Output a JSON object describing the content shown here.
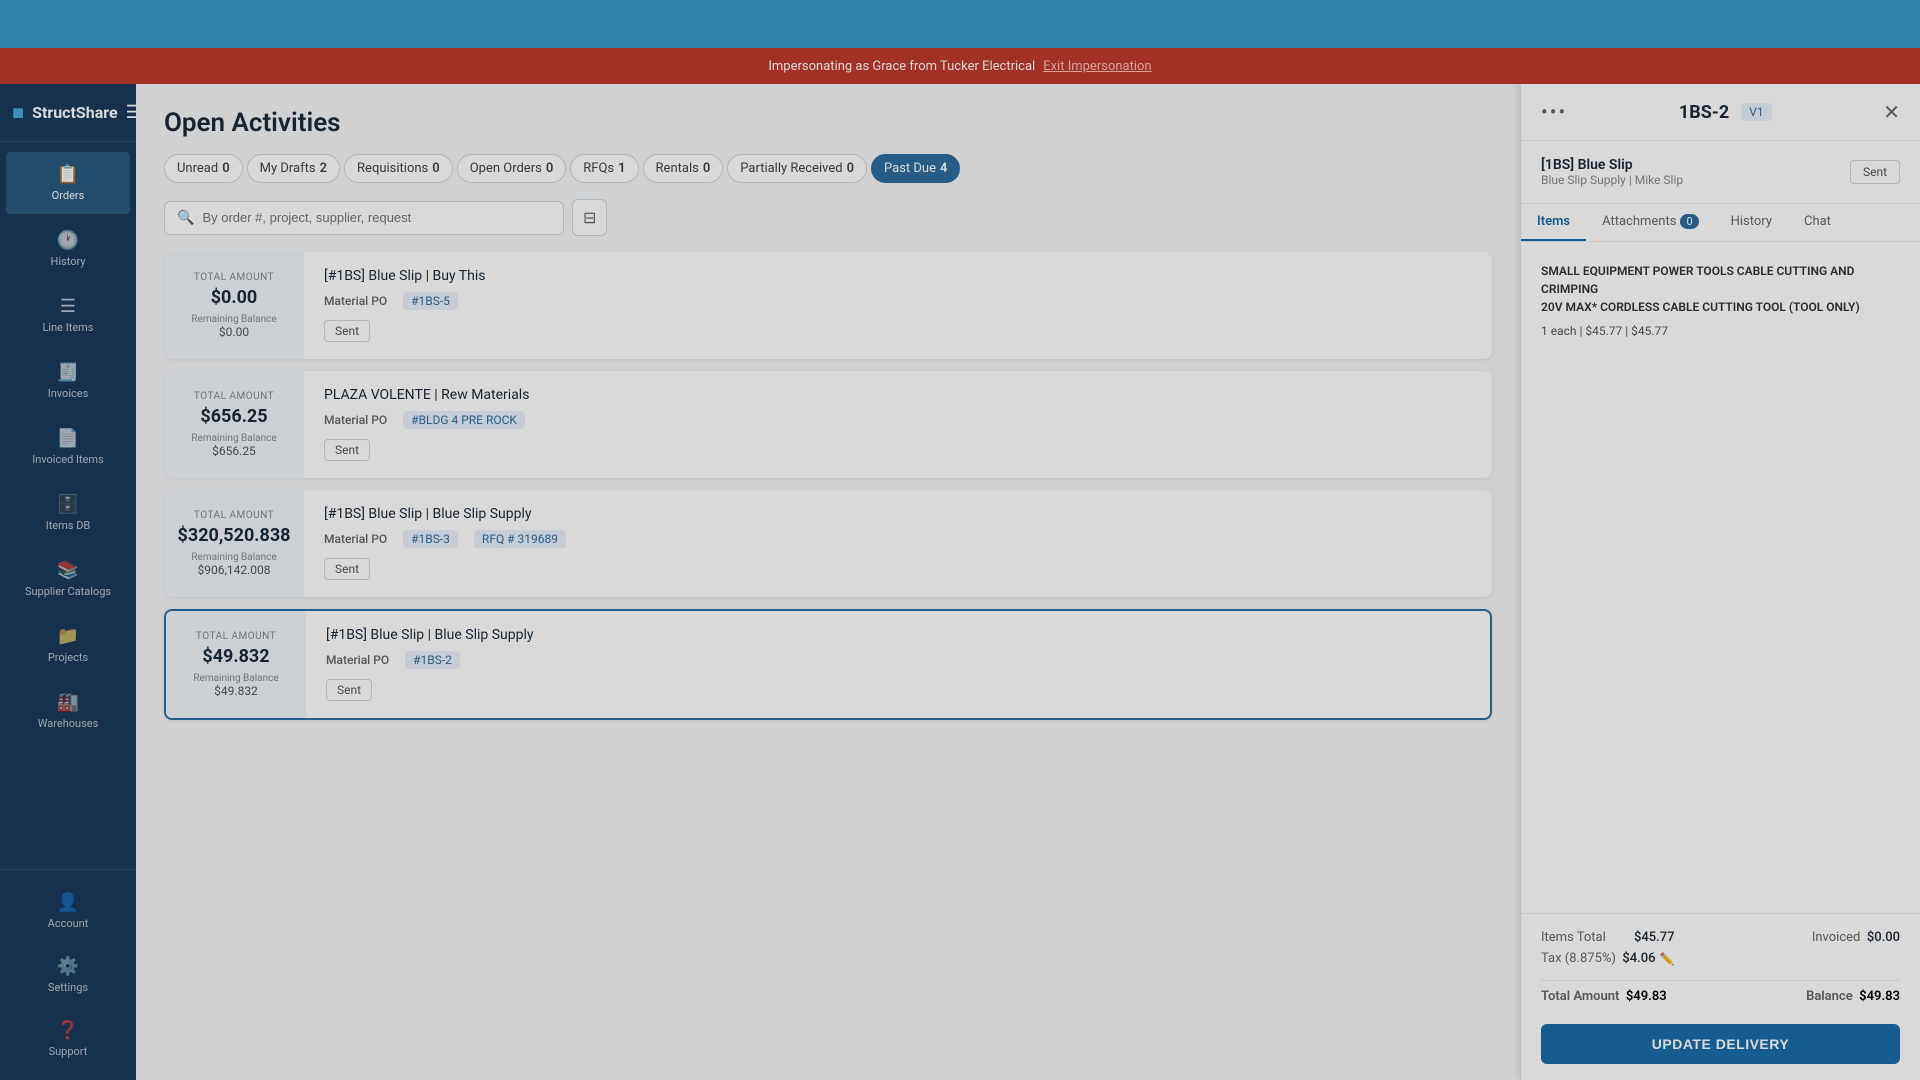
{
  "topBar": {
    "appName": "StructShare"
  },
  "impersonation": {
    "message": "Impersonating as Grace from Tucker Electrical",
    "linkText": "Exit Impersonation"
  },
  "sidebar": {
    "logoText": "StructShare",
    "items": [
      {
        "id": "orders",
        "label": "Orders",
        "icon": "📋",
        "active": true
      },
      {
        "id": "history",
        "label": "History",
        "icon": "🕐",
        "active": false
      },
      {
        "id": "line-items",
        "label": "Line Items",
        "icon": "☰",
        "active": false
      },
      {
        "id": "invoices",
        "label": "Invoices",
        "icon": "🧾",
        "active": false
      },
      {
        "id": "invoiced-items",
        "label": "Invoiced Items",
        "icon": "📄",
        "active": false
      },
      {
        "id": "items-db",
        "label": "Items DB",
        "icon": "🗄️",
        "active": false
      },
      {
        "id": "supplier-catalogs",
        "label": "Supplier Catalogs",
        "icon": "📚",
        "active": false
      },
      {
        "id": "projects",
        "label": "Projects",
        "icon": "📁",
        "active": false
      },
      {
        "id": "warehouses",
        "label": "Warehouses",
        "icon": "🏭",
        "active": false
      }
    ],
    "bottomItems": [
      {
        "id": "account",
        "label": "Account",
        "icon": "👤"
      },
      {
        "id": "settings",
        "label": "Settings",
        "icon": "⚙️"
      },
      {
        "id": "support",
        "label": "Support",
        "icon": "❓"
      }
    ]
  },
  "mainTitle": "Open Activities",
  "filterTabs": [
    {
      "id": "unread",
      "label": "Unread",
      "count": "0",
      "active": false
    },
    {
      "id": "my-drafts",
      "label": "My Drafts",
      "count": "2",
      "active": false
    },
    {
      "id": "requisitions",
      "label": "Requisitions",
      "count": "0",
      "active": false
    },
    {
      "id": "open-orders",
      "label": "Open Orders",
      "count": "0",
      "active": false
    },
    {
      "id": "rfqs",
      "label": "RFQs",
      "count": "1",
      "active": false
    },
    {
      "id": "rentals",
      "label": "Rentals",
      "count": "0",
      "active": false
    },
    {
      "id": "partially-received",
      "label": "Partially Received",
      "count": "0",
      "active": false
    },
    {
      "id": "past-due",
      "label": "Past Due",
      "count": "4",
      "active": true
    }
  ],
  "search": {
    "placeholder": "By order #, project, supplier, request"
  },
  "orders": [
    {
      "id": "order-1",
      "totalLabel": "TOTAL AMOUNT",
      "totalAmount": "$0.00",
      "remainingLabel": "Remaining Balance",
      "remainingAmount": "$0.00",
      "title": "[#1BS] Blue Slip",
      "titleSuffix": "Buy This",
      "poLabel": "Material PO",
      "poNumber": "#1BS-5",
      "rfqNumber": "",
      "status": "Sent"
    },
    {
      "id": "order-2",
      "totalLabel": "TOTAL AMOUNT",
      "totalAmount": "$656.25",
      "remainingLabel": "Remaining Balance",
      "remainingAmount": "$656.25",
      "title": "PLAZA VOLENTE",
      "titleSuffix": "Rew Materials",
      "poLabel": "Material PO",
      "poNumber": "#BLDG 4 PRE ROCK",
      "rfqNumber": "",
      "status": "Sent"
    },
    {
      "id": "order-3",
      "totalLabel": "TOTAL AMOUNT",
      "totalAmount": "$320,520.838",
      "remainingLabel": "Remaining Balance",
      "remainingAmount": "$906,142.008",
      "title": "[#1BS] Blue Slip",
      "titleSuffix": "Blue Slip Supply",
      "poLabel": "Material PO",
      "poNumber": "#1BS-3",
      "rfqNumber": "RFQ # 319689",
      "status": "Sent"
    },
    {
      "id": "order-4",
      "totalLabel": "TOTAL AMOUNT",
      "totalAmount": "$49.832",
      "remainingLabel": "Remaining Balance",
      "remainingAmount": "$49.832",
      "title": "[#1BS] Blue Slip",
      "titleSuffix": "Blue Slip Supply",
      "poLabel": "Material PO",
      "poNumber": "#1BS-2",
      "rfqNumber": "",
      "status": "Sent"
    }
  ],
  "rightPanel": {
    "orderId": "1BS-2",
    "version": "V1",
    "moreIcon": "•••",
    "closeIcon": "✕",
    "orderName": "[1BS] Blue Slip",
    "orderSub": "Blue Slip Supply | Mike Slip",
    "statusBadge": "Sent",
    "tabs": [
      {
        "id": "items",
        "label": "Items",
        "active": true,
        "count": null
      },
      {
        "id": "attachments",
        "label": "Attachments",
        "active": false,
        "count": "0"
      },
      {
        "id": "history",
        "label": "History",
        "active": false,
        "count": null
      },
      {
        "id": "chat",
        "label": "Chat",
        "active": false,
        "count": null
      }
    ],
    "itemDescription": "SMALL EQUIPMENT POWER TOOLS CABLE CUTTING AND CRIMPING\n20V MAX* Cordless Cable Cutting Tool (Tool Only)",
    "itemDetail": "1 each | $45.77 | $45.77",
    "footer": {
      "itemsTotalLabel": "Items Total",
      "itemsTotalValue": "$45.77",
      "taxLabel": "Tax (8.875%)",
      "taxValue": "$4.06",
      "taxEditIcon": "✏️",
      "invoicedLabel": "Invoiced",
      "invoicedValue": "$0.00",
      "totalAmountLabel": "Total Amount",
      "totalAmountValue": "$49.83",
      "balanceLabel": "Balance",
      "balanceValue": "$49.83",
      "updateBtnLabel": "UPDATE DELIVERY"
    }
  }
}
